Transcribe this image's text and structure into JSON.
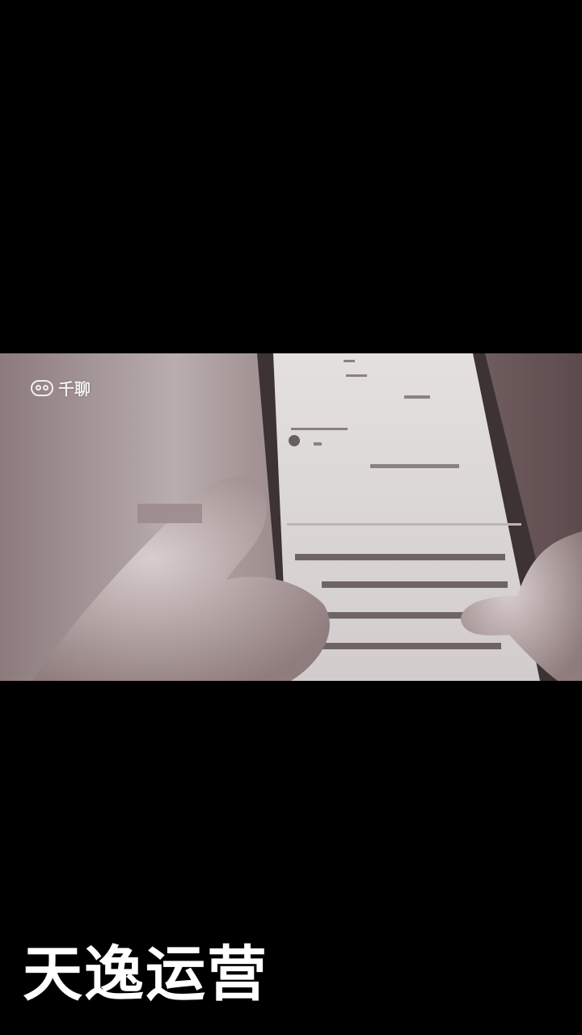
{
  "video": {
    "watermark_text": "千聊",
    "logo_icon": "owl-face-icon"
  },
  "caption": {
    "text": "天逸运营"
  },
  "colors": {
    "background": "#000000",
    "caption": "#ffffff",
    "watermark": "#f2eeee"
  }
}
